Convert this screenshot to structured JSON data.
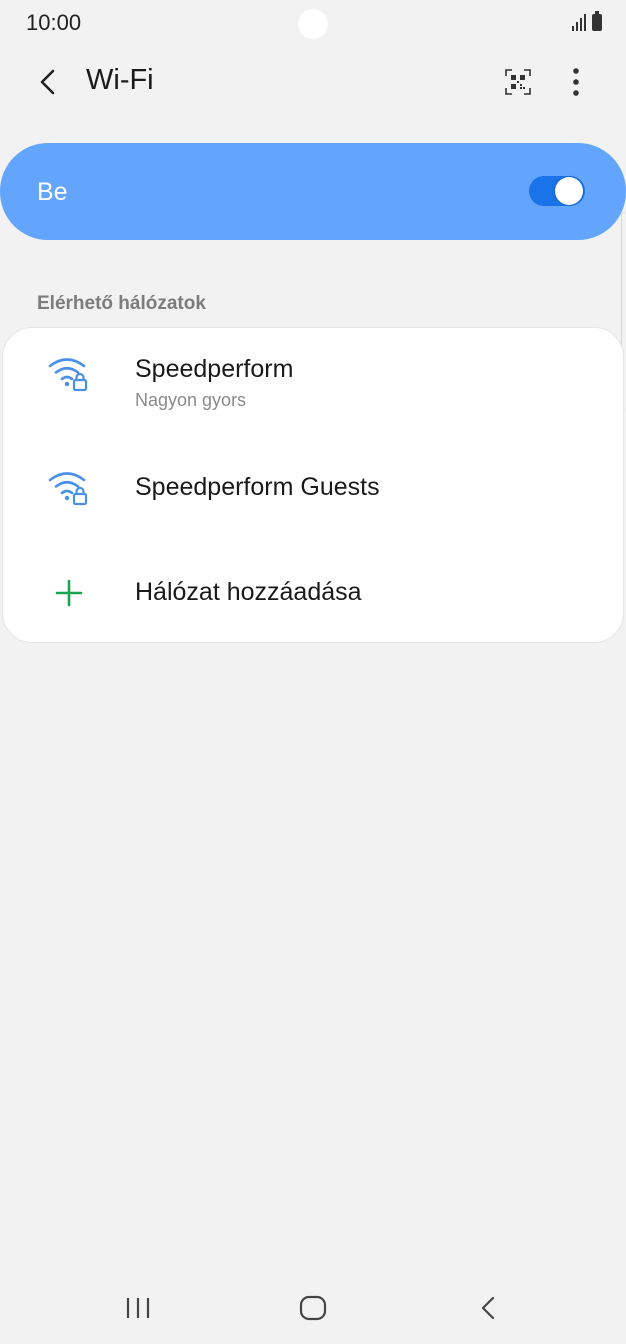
{
  "status_bar": {
    "time": "10:00",
    "icons": [
      "signal-icon",
      "battery-icon"
    ]
  },
  "header": {
    "title": "Wi-Fi",
    "back_icon": "chevron-left-icon",
    "qr_icon": "qr-code-scanner-icon",
    "more_icon": "more-vertical-icon"
  },
  "master_toggle": {
    "label": "Be",
    "on": true,
    "color_bg": "#63a5fd",
    "color_switch": "#1a73e8"
  },
  "available_networks": {
    "section_title": "Elérhető hálózatok",
    "items": [
      {
        "name": "Speedperform",
        "status": "Nagyon gyors",
        "icon": "wifi-lock-icon"
      },
      {
        "name": "Speedperform Guests",
        "status": "",
        "icon": "wifi-lock-icon"
      }
    ],
    "add_network": {
      "label": "Hálózat hozzáadása",
      "icon": "plus-icon",
      "color": "#1aa550"
    }
  },
  "nav_bar": {
    "icons": [
      "recent-apps-icon",
      "home-icon",
      "back-icon"
    ]
  }
}
